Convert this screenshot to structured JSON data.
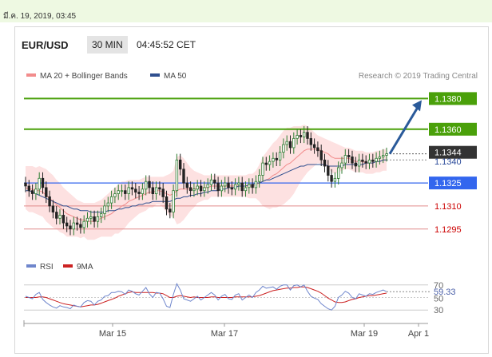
{
  "header": {
    "timestamp": "มี.ค. 19, 2019, 03:45",
    "symbol": "EUR/USD",
    "interval": "30 MIN",
    "time": "04:45:52 CET",
    "credit": "Research © 2019 Trading Central"
  },
  "legend": {
    "ma20": {
      "label": "MA 20 + Bollinger Bands",
      "color": "#f28c8c"
    },
    "ma50": {
      "label": "MA 50",
      "color": "#2f4f8f"
    }
  },
  "rsi_legend": {
    "rsi": {
      "label": "RSI",
      "color": "#6f86cc"
    },
    "ma9": {
      "label": "9MA",
      "color": "#cc2222"
    }
  },
  "colors": {
    "resistance": "#4aa00a",
    "pivot": "#3366ee",
    "support": "#e08a8a",
    "support_text": "#cc0000",
    "arrow": "#2a5a9a",
    "candle_up": "#2e7d32",
    "candle_down": "#222222",
    "band_fill": "#fde1e1"
  },
  "chart_data": [
    {
      "type": "line",
      "subtype": "candlestick",
      "ylim": [
        1.1285,
        1.1388
      ],
      "x_tick_labels": [
        "Mar 15",
        "Mar 17",
        "Mar 19",
        "Apr 1"
      ],
      "price_labels": {
        "r2": "1.1380",
        "r1": "1.1360",
        "current": "1.1344",
        "ma_value": "1.1340",
        "pivot": "1.1325",
        "s1": "1.1310",
        "s2": "1.1295"
      },
      "levels": [
        {
          "role": "resistance",
          "value": 1.138
        },
        {
          "role": "resistance",
          "value": 1.136
        },
        {
          "role": "current",
          "value": 1.1344
        },
        {
          "role": "ma",
          "value": 1.134
        },
        {
          "role": "pivot",
          "value": 1.1325
        },
        {
          "role": "support",
          "value": 1.131
        },
        {
          "role": "support",
          "value": 1.1295
        }
      ],
      "closes": [
        1.1323,
        1.132,
        1.1318,
        1.1321,
        1.1328,
        1.1322,
        1.1316,
        1.131,
        1.1306,
        1.1302,
        1.1304,
        1.1299,
        1.1297,
        1.1295,
        1.1299,
        1.1298,
        1.1296,
        1.13,
        1.1302,
        1.1303,
        1.13,
        1.1303,
        1.1305,
        1.131,
        1.1312,
        1.1316,
        1.1318,
        1.132,
        1.132,
        1.1318,
        1.1322,
        1.1321,
        1.1319,
        1.1318,
        1.1321,
        1.1326,
        1.1322,
        1.1318,
        1.1322,
        1.1321,
        1.1316,
        1.1308,
        1.1306,
        1.132,
        1.134,
        1.1334,
        1.1325,
        1.1322,
        1.132,
        1.1321,
        1.1323,
        1.132,
        1.1322,
        1.1324,
        1.1327,
        1.1325,
        1.132,
        1.1323,
        1.1325,
        1.1322,
        1.1321,
        1.1324,
        1.1325,
        1.132,
        1.1322,
        1.1324,
        1.1322,
        1.1326,
        1.133,
        1.1338,
        1.1337,
        1.1339,
        1.1341,
        1.134,
        1.1345,
        1.135,
        1.1352,
        1.1348,
        1.1354,
        1.1356,
        1.1355,
        1.1358,
        1.1354,
        1.135,
        1.1348,
        1.1346,
        1.134,
        1.1336,
        1.133,
        1.1326,
        1.1328,
        1.1335,
        1.1338,
        1.1343,
        1.1342,
        1.1338,
        1.1336,
        1.134,
        1.1339,
        1.1338,
        1.134,
        1.1339,
        1.1341,
        1.1342,
        1.1343,
        1.1344
      ],
      "ma20": [
        1.1322,
        1.1321,
        1.1321,
        1.132,
        1.132,
        1.1319,
        1.1317,
        1.1315,
        1.1313,
        1.1311,
        1.1309,
        1.1307,
        1.1305,
        1.1304,
        1.1303,
        1.1302,
        1.1301,
        1.1301,
        1.13,
        1.13,
        1.13,
        1.1301,
        1.1302,
        1.1303,
        1.1304,
        1.1305,
        1.1307,
        1.1308,
        1.131,
        1.1311,
        1.1313,
        1.1314,
        1.1315,
        1.1316,
        1.1317,
        1.1318,
        1.1319,
        1.1319,
        1.132,
        1.132,
        1.1319,
        1.1318,
        1.1317,
        1.1318,
        1.132,
        1.1321,
        1.1321,
        1.1321,
        1.1321,
        1.1321,
        1.1322,
        1.1322,
        1.1322,
        1.1322,
        1.1323,
        1.1323,
        1.1323,
        1.1323,
        1.1323,
        1.1323,
        1.1323,
        1.1323,
        1.1323,
        1.1323,
        1.1323,
        1.1323,
        1.1323,
        1.1324,
        1.1325,
        1.1326,
        1.1327,
        1.1328,
        1.133,
        1.1331,
        1.1333,
        1.1335,
        1.1337,
        1.1338,
        1.134,
        1.1342,
        1.1344,
        1.1346,
        1.1347,
        1.1347,
        1.1347,
        1.1347,
        1.1346,
        1.1345,
        1.1344,
        1.1342,
        1.1341,
        1.1341,
        1.1341,
        1.1341,
        1.1341,
        1.134,
        1.1339,
        1.1339,
        1.1339,
        1.1338,
        1.1338,
        1.1338,
        1.1339,
        1.1339,
        1.134,
        1.134
      ],
      "ma50": [
        1.132,
        1.132,
        1.1319,
        1.1318,
        1.1317,
        1.1316,
        1.1315,
        1.1314,
        1.1313,
        1.1312,
        1.1311,
        1.131,
        1.131,
        1.1309,
        1.1308,
        1.1308,
        1.1307,
        1.1307,
        1.1307,
        1.1306,
        1.1306,
        1.1306,
        1.1306,
        1.1306,
        1.1307,
        1.1307,
        1.1307,
        1.1308,
        1.1308,
        1.1309,
        1.1309,
        1.131,
        1.131,
        1.1311,
        1.1311,
        1.1312,
        1.1312,
        1.1313,
        1.1313,
        1.1313,
        1.1313,
        1.1313,
        1.1313,
        1.1314,
        1.1315,
        1.1315,
        1.1316,
        1.1316,
        1.1317,
        1.1317,
        1.1318,
        1.1318,
        1.1319,
        1.1319,
        1.132,
        1.132,
        1.132,
        1.1321,
        1.1321,
        1.1322,
        1.1322,
        1.1322,
        1.1323,
        1.1323,
        1.1323,
        1.1324,
        1.1324,
        1.1325,
        1.1325,
        1.1326,
        1.1327,
        1.1327,
        1.1328,
        1.1329,
        1.133,
        1.1331,
        1.1332,
        1.1333,
        1.1334,
        1.1335,
        1.1336,
        1.1336,
        1.1337,
        1.1337,
        1.1337,
        1.1337,
        1.1337,
        1.1337,
        1.1336,
        1.1336,
        1.1336,
        1.1336,
        1.1336,
        1.1337,
        1.1337,
        1.1337,
        1.1337,
        1.1337,
        1.1337,
        1.1338,
        1.1338,
        1.1338,
        1.1339,
        1.1339,
        1.134,
        1.134
      ],
      "band_upper": [
        1.1336,
        1.1336,
        1.1336,
        1.1335,
        1.1336,
        1.1335,
        1.1334,
        1.1332,
        1.133,
        1.1327,
        1.1325,
        1.1322,
        1.132,
        1.1318,
        1.1316,
        1.1314,
        1.1313,
        1.1312,
        1.1312,
        1.1312,
        1.1312,
        1.1313,
        1.1314,
        1.1316,
        1.1318,
        1.132,
        1.1322,
        1.1324,
        1.1326,
        1.1326,
        1.1327,
        1.1327,
        1.1327,
        1.1327,
        1.1328,
        1.1329,
        1.1329,
        1.1329,
        1.1329,
        1.1329,
        1.1329,
        1.133,
        1.1331,
        1.1333,
        1.1342,
        1.1343,
        1.1341,
        1.1338,
        1.1335,
        1.1333,
        1.1332,
        1.1331,
        1.133,
        1.133,
        1.133,
        1.133,
        1.133,
        1.133,
        1.133,
        1.133,
        1.133,
        1.133,
        1.133,
        1.133,
        1.133,
        1.1331,
        1.1331,
        1.1333,
        1.1337,
        1.1342,
        1.1345,
        1.1348,
        1.1351,
        1.1353,
        1.1356,
        1.1359,
        1.1361,
        1.1361,
        1.1362,
        1.1362,
        1.1362,
        1.1363,
        1.1362,
        1.136,
        1.1358,
        1.1356,
        1.1355,
        1.1354,
        1.1353,
        1.1352,
        1.1351,
        1.135,
        1.1349,
        1.1348,
        1.1348,
        1.1347,
        1.1346,
        1.1346,
        1.1346,
        1.1345,
        1.1345,
        1.1345,
        1.1346,
        1.1346,
        1.1347,
        1.1347
      ],
      "band_lower": [
        1.1308,
        1.1306,
        1.1306,
        1.1305,
        1.1304,
        1.1303,
        1.13,
        1.1298,
        1.1296,
        1.1295,
        1.1293,
        1.1292,
        1.129,
        1.129,
        1.129,
        1.129,
        1.1289,
        1.129,
        1.1288,
        1.1288,
        1.1288,
        1.1289,
        1.129,
        1.129,
        1.129,
        1.129,
        1.1292,
        1.1292,
        1.1294,
        1.1296,
        1.1299,
        1.1301,
        1.1303,
        1.1305,
        1.1306,
        1.1307,
        1.1309,
        1.1309,
        1.1311,
        1.1311,
        1.1309,
        1.1306,
        1.1303,
        1.1303,
        1.1298,
        1.1299,
        1.1301,
        1.1304,
        1.1307,
        1.1309,
        1.1312,
        1.1313,
        1.1314,
        1.1314,
        1.1316,
        1.1316,
        1.1316,
        1.1316,
        1.1316,
        1.1316,
        1.1316,
        1.1316,
        1.1316,
        1.1316,
        1.1316,
        1.1315,
        1.1315,
        1.1315,
        1.1313,
        1.131,
        1.1309,
        1.1308,
        1.1309,
        1.1309,
        1.131,
        1.1311,
        1.1313,
        1.1315,
        1.1318,
        1.1322,
        1.1326,
        1.1329,
        1.1332,
        1.1334,
        1.1336,
        1.1338,
        1.1337,
        1.1336,
        1.1335,
        1.1332,
        1.1331,
        1.1332,
        1.1333,
        1.1334,
        1.1334,
        1.1333,
        1.1332,
        1.1332,
        1.1332,
        1.1331,
        1.1331,
        1.1331,
        1.1332,
        1.1332,
        1.1333,
        1.1333
      ],
      "projection_target": 1.138
    },
    {
      "type": "line",
      "title": "",
      "ylim": [
        20,
        80
      ],
      "ticks": [
        "70",
        "30"
      ],
      "ref_levels": [
        70,
        50,
        30
      ],
      "current_label": "59.33",
      "mid_label": "50",
      "series": [
        {
          "name": "RSI",
          "values": [
            52,
            50,
            48,
            55,
            58,
            47,
            42,
            38,
            35,
            33,
            37,
            35,
            34,
            32,
            38,
            36,
            35,
            42,
            45,
            44,
            38,
            44,
            46,
            52,
            53,
            58,
            58,
            60,
            59,
            55,
            62,
            60,
            56,
            54,
            60,
            66,
            56,
            50,
            58,
            57,
            48,
            36,
            34,
            55,
            72,
            62,
            48,
            46,
            44,
            48,
            52,
            46,
            50,
            54,
            58,
            54,
            46,
            52,
            55,
            48,
            47,
            54,
            56,
            46,
            50,
            54,
            50,
            58,
            62,
            68,
            65,
            66,
            67,
            63,
            68,
            70,
            70,
            62,
            69,
            70,
            67,
            70,
            60,
            52,
            49,
            47,
            40,
            36,
            32,
            30,
            36,
            50,
            54,
            60,
            57,
            50,
            48,
            56,
            54,
            52,
            56,
            55,
            58,
            60,
            62,
            59.33
          ]
        },
        {
          "name": "9MA",
          "values": [
            50,
            50,
            50,
            50,
            51,
            51,
            50,
            48,
            46,
            44,
            42,
            40,
            39,
            38,
            37,
            36,
            35,
            36,
            37,
            38,
            38,
            39,
            41,
            43,
            45,
            47,
            49,
            52,
            54,
            56,
            58,
            59,
            58,
            58,
            58,
            58,
            58,
            58,
            57,
            57,
            56,
            53,
            50,
            50,
            52,
            53,
            52,
            51,
            50,
            51,
            50,
            50,
            50,
            50,
            51,
            51,
            50,
            50,
            50,
            50,
            50,
            51,
            51,
            51,
            51,
            51,
            51,
            52,
            53,
            55,
            57,
            59,
            61,
            62,
            63,
            64,
            65,
            65,
            66,
            66,
            67,
            67,
            66,
            64,
            62,
            60,
            57,
            53,
            49,
            46,
            43,
            42,
            42,
            43,
            45,
            47,
            48,
            50,
            51,
            52,
            53,
            53,
            54,
            55,
            56,
            57
          ]
        }
      ]
    }
  ]
}
